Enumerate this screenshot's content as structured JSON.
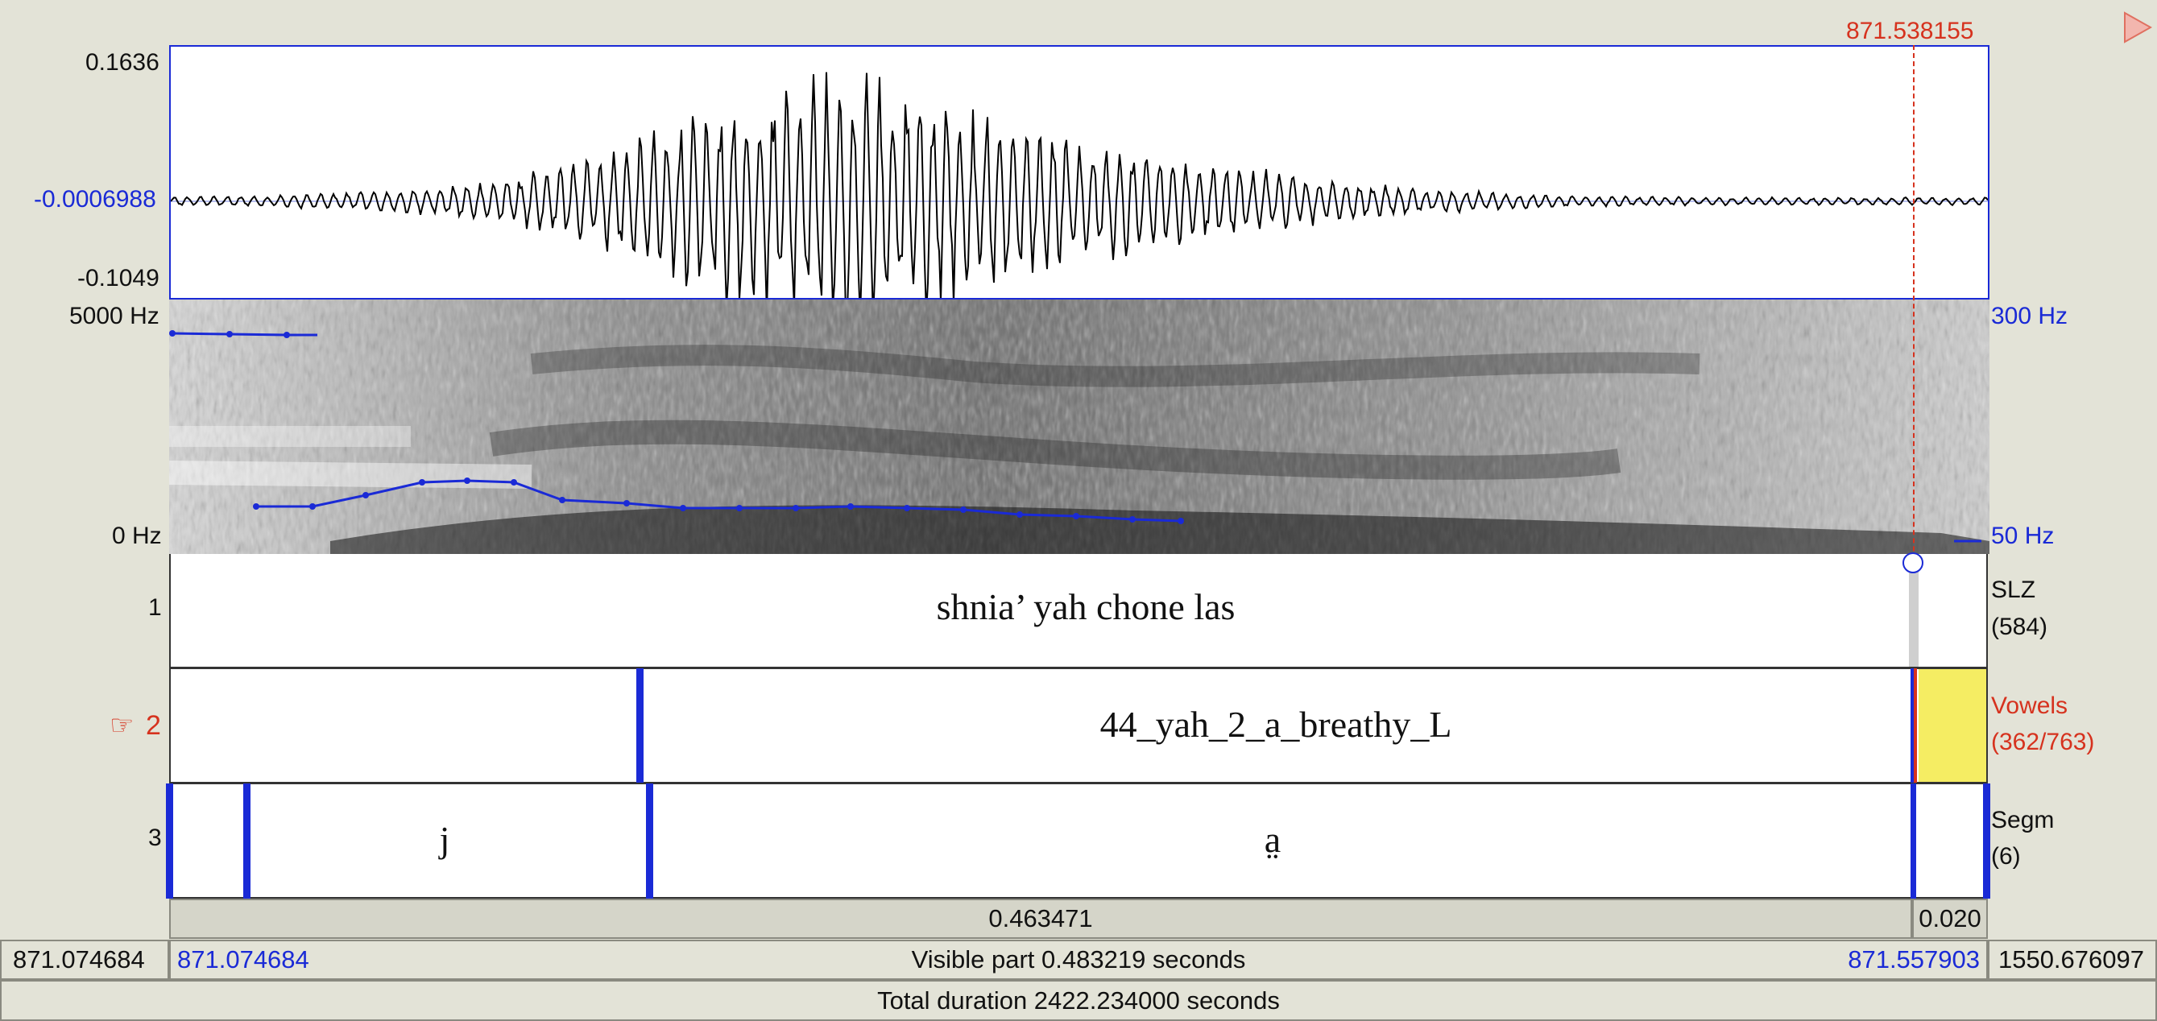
{
  "cursor": {
    "time": "871.538155"
  },
  "waveform": {
    "max_label": "0.1636",
    "mid_label": "-0.0006988",
    "min_label": "-0.1049"
  },
  "spectrogram": {
    "freq_top": "5000 Hz",
    "freq_bottom": "0 Hz",
    "pitch_top": "300 Hz",
    "pitch_bottom": "50 Hz"
  },
  "tiers": [
    {
      "number": "1",
      "name": "SLZ",
      "count": "(584)",
      "text": "shnia’ yah chone las"
    },
    {
      "number": "2",
      "marker": "☞",
      "name": "Vowels",
      "count": "(362/763)",
      "text": "44_yah_2_a_breathy_L"
    },
    {
      "number": "3",
      "name": "Segm",
      "count": "(6)",
      "segments": [
        "j",
        "a̤"
      ]
    }
  ],
  "duration_row": {
    "selection": "0.463471",
    "remainder": "0.020"
  },
  "visible_row": {
    "left_outside": "871.074684",
    "start": "871.074684",
    "label": "Visible part 0.483219 seconds",
    "end": "871.557903",
    "right_outside": "1550.676097"
  },
  "total_row": {
    "label": "Total duration 2422.234000 seconds"
  },
  "colors": {
    "accent_blue": "#1a2ad6",
    "cursor_red": "#d6321e",
    "selection_yellow": "#f5ed63",
    "background": "#e3e3d7"
  },
  "icons": {
    "play": "play-triangle-icon",
    "tier_pointer": "pointing-hand-icon"
  }
}
